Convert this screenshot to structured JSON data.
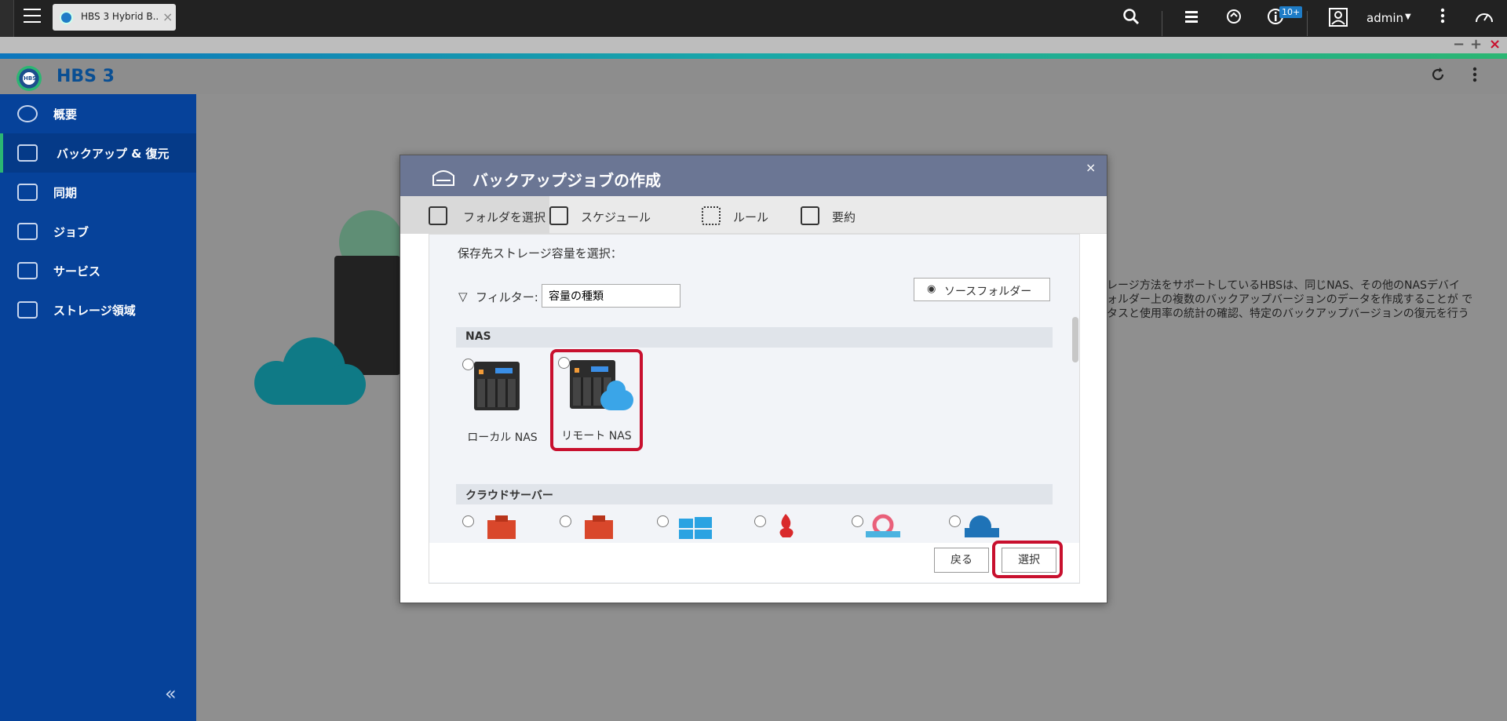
{
  "topbar": {
    "tab_title": "HBS 3 Hybrid B...",
    "tab_close": "×",
    "notification_badge": "10+",
    "user": "admin"
  },
  "window_controls": {
    "minimize": "−",
    "maximize": "+",
    "close": "×"
  },
  "app": {
    "title": "HBS 3",
    "logo_text": "HBS"
  },
  "sidebar": {
    "items": [
      {
        "label": "概要"
      },
      {
        "label": "バックアップ & 復元"
      },
      {
        "label": "同期"
      },
      {
        "label": "ジョブ"
      },
      {
        "label": "サービス"
      },
      {
        "label": "ストレージ領域"
      }
    ],
    "collapse": "«"
  },
  "background": {
    "description_lines": [
      "レージ方法をサポートしているHBSは、同じNAS、その他のNASデバイ",
      "ォルダー上の複数のバックアップバージョンのデータを作成することが で",
      "タスと使用率の統計の確認、特定のバックアップバージョンの復元を行う"
    ]
  },
  "dialog": {
    "title": "バックアップジョブの作成",
    "close": "×",
    "steps": [
      {
        "label": "フォルダを選択"
      },
      {
        "label": "スケジュール"
      },
      {
        "label": "ルール"
      },
      {
        "label": "要約"
      }
    ],
    "section_label": "保存先ストレージ容量を選択：",
    "filter_label": "フィルター:",
    "filter_value": "容量の種類",
    "source_folder_button": "ソースフォルダー",
    "groups": [
      {
        "title": "NAS",
        "options": [
          {
            "label": "ローカル NAS"
          },
          {
            "label": "リモート NAS"
          }
        ]
      },
      {
        "title": "クラウドサーバー"
      }
    ],
    "back_button": "戻る",
    "select_button": "選択"
  },
  "colors": {
    "sidebar": "#06429a",
    "dialog_header": "#6b7694",
    "highlight": "#c8102e",
    "brand": "#0a4f93"
  }
}
